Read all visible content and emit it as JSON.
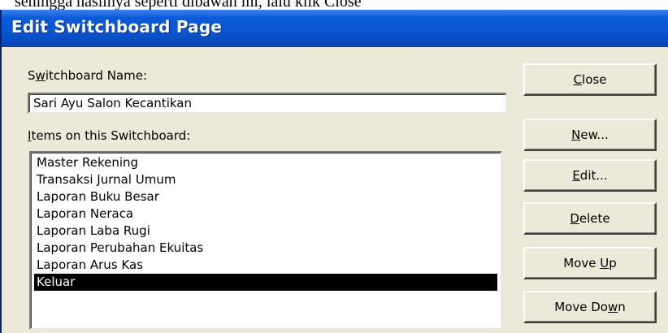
{
  "document_text": "sehingga hasilnya seperti dibawah ini, lalu klik Close",
  "dialog": {
    "title": "Edit Switchboard Page",
    "name_label": {
      "pre": "S",
      "key": "w",
      "post": "itchboard Name:"
    },
    "name_value": "Sari Ayu Salon Kecantikan",
    "items_label": {
      "pre": "",
      "key": "I",
      "post": "tems on this Switchboard:"
    },
    "items": [
      "Master Rekening",
      "Transaksi Jurnal Umum",
      "Laporan Buku Besar",
      "Laporan Neraca",
      "Laporan Laba Rugi",
      "Laporan Perubahan Ekuitas",
      "Laporan Arus Kas",
      "Keluar"
    ],
    "selected_item": "Keluar"
  },
  "buttons": {
    "close": {
      "pre": "",
      "key": "C",
      "post": "lose"
    },
    "new": {
      "pre": "",
      "key": "N",
      "post": "ew..."
    },
    "edit": {
      "pre": "",
      "key": "E",
      "post": "dit..."
    },
    "delete": {
      "pre": "",
      "key": "D",
      "post": "elete"
    },
    "move_up": {
      "pre": "Move ",
      "key": "U",
      "post": "p"
    },
    "move_down": {
      "pre": "Move Do",
      "key": "w",
      "post": "n"
    }
  },
  "colors": {
    "titlebar": "#0a5ad8",
    "dialog_face": "#ece9d8",
    "selection": "#000000"
  }
}
